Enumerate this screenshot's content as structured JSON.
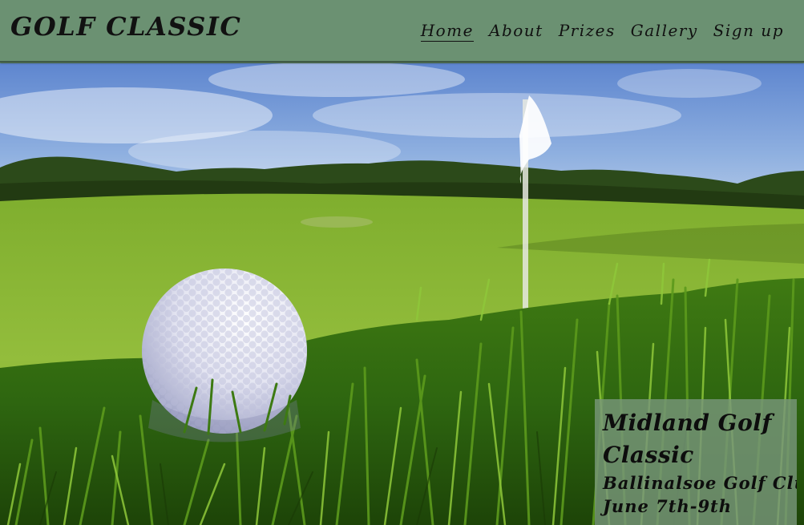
{
  "header": {
    "logo": "GOLF CLASSIC",
    "nav": [
      {
        "label": "Home",
        "active": true
      },
      {
        "label": "About",
        "active": false
      },
      {
        "label": "Prizes",
        "active": false
      },
      {
        "label": "Gallery",
        "active": false
      },
      {
        "label": "Sign up",
        "active": false
      }
    ]
  },
  "hero": {
    "event_title": "Midland Golf Classic",
    "venue": "Ballinalsoe Golf Club",
    "dates": "June 7th-9th"
  },
  "colors": {
    "header_bg": "#6b9172",
    "card_bg": "#78967a",
    "text": "#111111"
  }
}
